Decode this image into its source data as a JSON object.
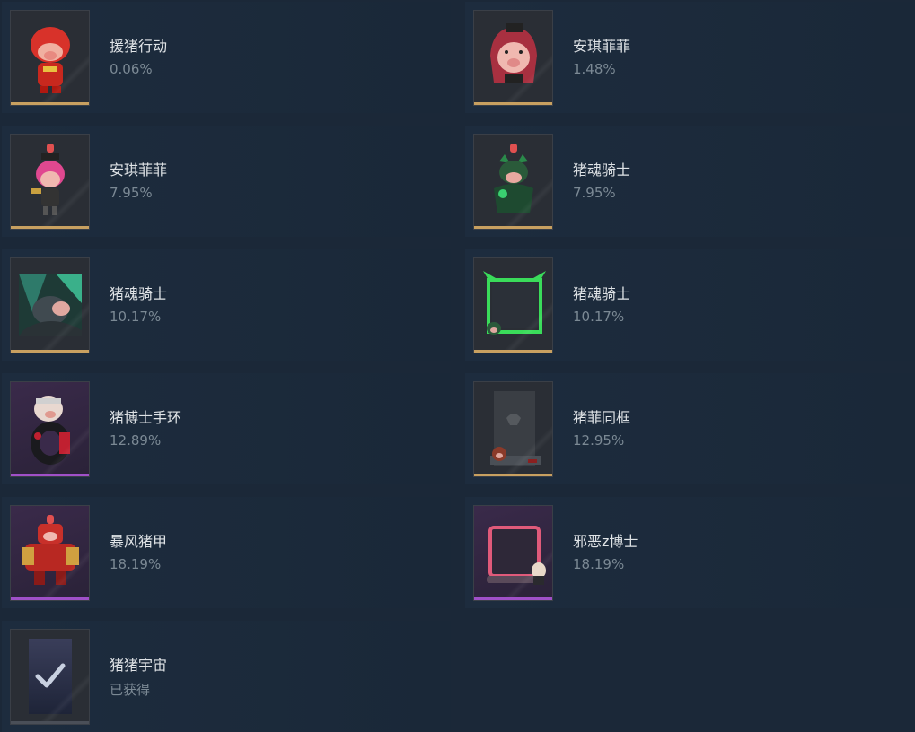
{
  "achievements": [
    {
      "title": "援猪行动",
      "percent": "0.06%",
      "rarity": "gold",
      "icon": "red-pig-figure-icon"
    },
    {
      "title": "安琪菲菲",
      "percent": "1.48%",
      "rarity": "gold",
      "icon": "pink-pig-girl-portrait-icon"
    },
    {
      "title": "安琪菲菲",
      "percent": "7.95%",
      "rarity": "gold",
      "icon": "pink-pig-girl-figure-icon"
    },
    {
      "title": "猪魂骑士",
      "percent": "7.95%",
      "rarity": "gold",
      "icon": "green-knight-pig-figure-icon"
    },
    {
      "title": "猪魂骑士",
      "percent": "10.17%",
      "rarity": "gold",
      "icon": "knight-pig-card-icon"
    },
    {
      "title": "猪魂骑士",
      "percent": "10.17%",
      "rarity": "gold",
      "icon": "green-avatar-frame-icon"
    },
    {
      "title": "猪博士手环",
      "percent": "12.89%",
      "rarity": "epic",
      "icon": "dr-pig-bracelet-icon"
    },
    {
      "title": "猪菲同框",
      "percent": "12.95%",
      "rarity": "gold",
      "icon": "pig-photo-frame-icon"
    },
    {
      "title": "暴风猪甲",
      "percent": "18.19%",
      "rarity": "epic",
      "icon": "storm-pig-mech-icon"
    },
    {
      "title": "邪恶z博士",
      "percent": "18.19%",
      "rarity": "epic",
      "icon": "evil-dr-z-frame-icon"
    },
    {
      "title": "猪猪宇宙",
      "percent": "已获得",
      "rarity": "plain",
      "icon": "checkmark-card-icon"
    }
  ],
  "colors": {
    "gold": "#c8a060",
    "epic": "#a050c8",
    "background": "#1b2838"
  }
}
